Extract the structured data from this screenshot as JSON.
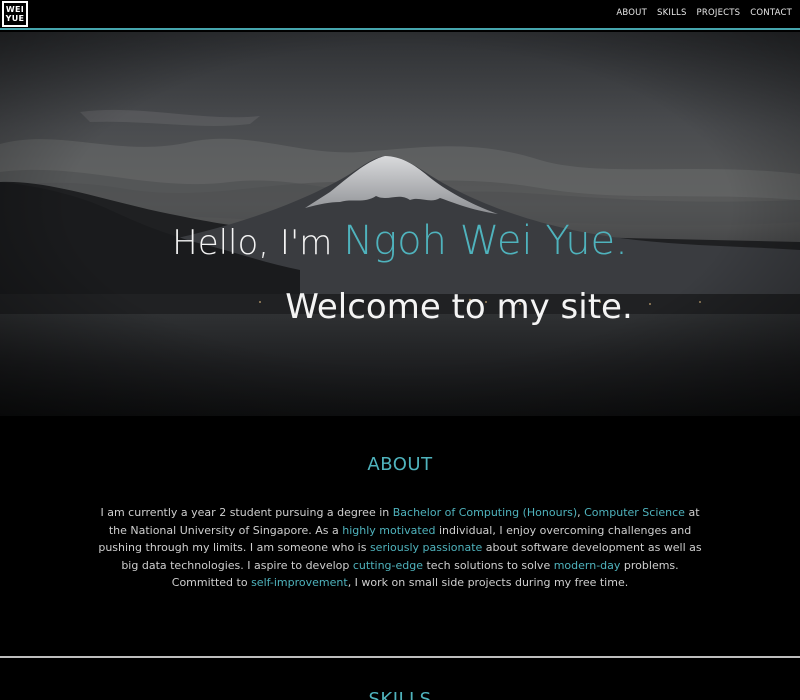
{
  "logo": {
    "line1": "WEI",
    "line2": "YUE"
  },
  "nav": {
    "items": [
      {
        "label": "ABOUT"
      },
      {
        "label": "SKILLS"
      },
      {
        "label": "PROJECTS"
      },
      {
        "label": "CONTACT"
      }
    ]
  },
  "hero": {
    "greeting": "Hello, I'm ",
    "name": "Ngoh Wei Yue.",
    "welcome": "Welcome to my site."
  },
  "about": {
    "title": "ABOUT",
    "segments": [
      {
        "text": "I am currently a year 2 student pursuing a degree in ",
        "highlight": false
      },
      {
        "text": "Bachelor of Computing (Honours)",
        "highlight": true
      },
      {
        "text": ", ",
        "highlight": false
      },
      {
        "text": "Computer Science",
        "highlight": true
      },
      {
        "text": " at the National University of Singapore. As a ",
        "highlight": false
      },
      {
        "text": "highly motivated",
        "highlight": true
      },
      {
        "text": " individual, I enjoy overcoming challenges and pushing through my limits. I am someone who is ",
        "highlight": false
      },
      {
        "text": "seriously passionate",
        "highlight": true
      },
      {
        "text": " about software development as well as big data technologies. I aspire to develop ",
        "highlight": false
      },
      {
        "text": "cutting-edge",
        "highlight": true
      },
      {
        "text": " tech solutions to solve ",
        "highlight": false
      },
      {
        "text": "modern-day",
        "highlight": true
      },
      {
        "text": " problems. Committed to ",
        "highlight": false
      },
      {
        "text": "self-improvement",
        "highlight": true
      },
      {
        "text": ", I work on small side projects during my free time.",
        "highlight": false
      }
    ]
  },
  "skills": {
    "title": "SKILLS"
  },
  "colors": {
    "accent": "#4fb3bd",
    "background": "#000000",
    "text": "#cfcfcf"
  }
}
